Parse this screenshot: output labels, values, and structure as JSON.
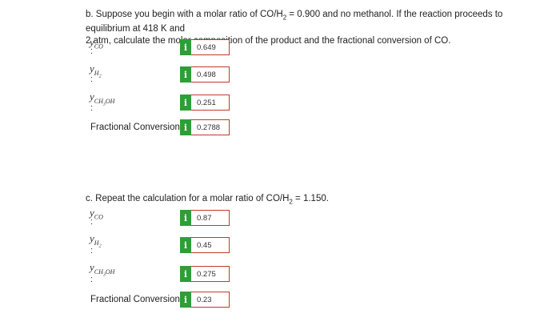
{
  "part_b": {
    "question_line1": "b. Suppose you begin with a molar ratio of CO/H",
    "question_sub1": "2",
    "question_line1b": " = 0.900 and no methanol. If the reaction proceeds to equilibrium at 418 K and",
    "question_line2": "2 atm, calculate the molar composition of the product and the fractional conversion of CO.",
    "y_co": "0.649",
    "y_h2": "0.498",
    "y_ch3oh": "0.251",
    "fractional_conversion_label": "Fractional Conversion:",
    "fractional_conversion": "0.2788"
  },
  "part_c": {
    "question_a": "c. Repeat the calculation for a molar ratio of CO/H",
    "question_sub": "2",
    "question_b": " = 1.150.",
    "y_co": "0.87",
    "y_h2": "0.45",
    "y_ch3oh": "0.275",
    "fractional_conversion_label": "Fractional Conversion:",
    "fractional_conversion": "0.23"
  },
  "symbols": {
    "y": "y",
    "sub_co": "CO",
    "sub_h2": "H",
    "sub_h2_sub": "2",
    "sub_ch3oh": "CH",
    "sub_ch3oh_num": "3",
    "sub_ch3oh_end": "OH",
    "colon": ":",
    "info": "i"
  },
  "colors": {
    "info_badge": "#2e9e36",
    "answer_border": "#c0392b"
  }
}
